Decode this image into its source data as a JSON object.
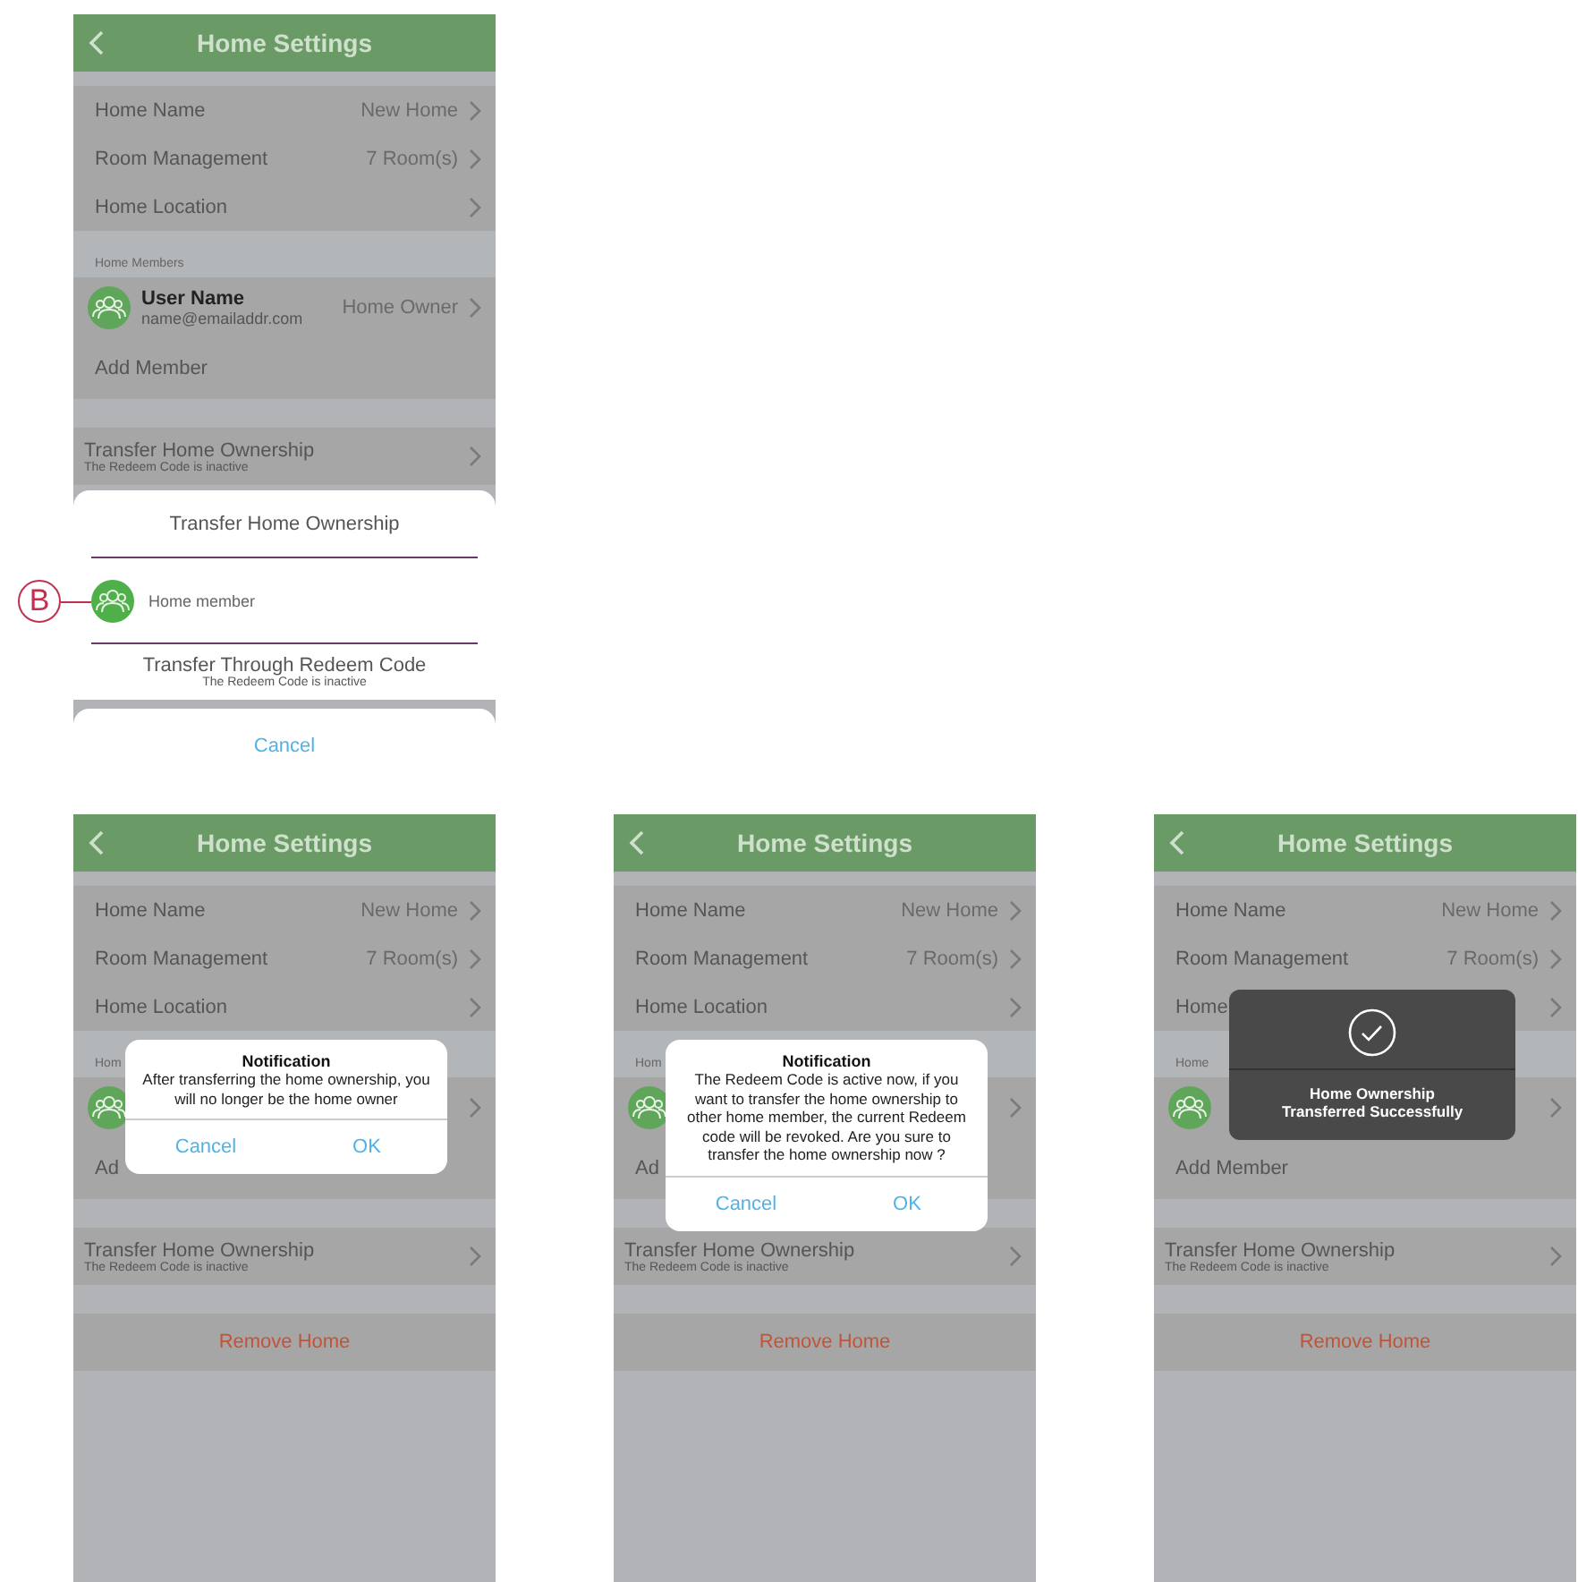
{
  "annotation": {
    "label": "B"
  },
  "screens": [
    {
      "title": "Home Settings",
      "settings": [
        {
          "label": "Home Name",
          "value": "New Home"
        },
        {
          "label": "Room Management",
          "value": "7 Room(s)"
        },
        {
          "label": "Home Location"
        }
      ],
      "members_header": "Home Members",
      "member": {
        "name": "User Name",
        "email": "name@emailaddr.com",
        "role": "Home Owner"
      },
      "add_member": "Add Member",
      "transfer": {
        "title": "Transfer Home Ownership",
        "subtitle": "The Redeem Code is inactive"
      },
      "overlay": {
        "kind": "sheet",
        "title": "Transfer Home Ownership",
        "member_option": "Home member",
        "redeem_option": {
          "title": "Transfer Through Redeem Code",
          "subtitle": "The Redeem Code is inactive"
        },
        "cancel": "Cancel"
      }
    },
    {
      "title": "Home Settings",
      "settings": [
        {
          "label": "Home Name",
          "value": "New Home"
        },
        {
          "label": "Room Management",
          "value": "7 Room(s)"
        },
        {
          "label": "Home Location"
        }
      ],
      "members_header": "Hom",
      "add_member": "Ad",
      "transfer": {
        "title": "Transfer Home Ownership",
        "subtitle": "The Redeem Code is inactive"
      },
      "remove_home": "Remove Home",
      "overlay": {
        "kind": "dialog",
        "title": "Notification",
        "message": "After transferring the home ownership, you will no longer be the home owner",
        "cancel": "Cancel",
        "ok": "OK"
      }
    },
    {
      "title": "Home Settings",
      "settings": [
        {
          "label": "Home Name",
          "value": "New Home"
        },
        {
          "label": "Room Management",
          "value": "7 Room(s)"
        },
        {
          "label": "Home Location"
        }
      ],
      "members_header": "Hom",
      "add_member": "Ad",
      "transfer": {
        "title": "Transfer Home Ownership",
        "subtitle": "The Redeem Code is inactive"
      },
      "remove_home": "Remove Home",
      "overlay": {
        "kind": "dialog",
        "title": "Notification",
        "message": "The Redeem Code is active now, if you want to transfer the home ownership to other home member, the current Redeem code will be revoked. Are you sure to transfer the home ownership now ?",
        "cancel": "Cancel",
        "ok": "OK"
      }
    },
    {
      "title": "Home Settings",
      "settings": [
        {
          "label": "Home Name",
          "value": "New Home"
        },
        {
          "label": "Room Management",
          "value": "7 Room(s)"
        },
        {
          "label": "Home"
        }
      ],
      "members_header": "Home",
      "add_member": "Add Member",
      "transfer": {
        "title": "Transfer Home Ownership",
        "subtitle": "The Redeem Code is inactive"
      },
      "remove_home": "Remove Home",
      "overlay": {
        "kind": "toast",
        "message": "Home Ownership Transferred Successfully"
      }
    }
  ]
}
